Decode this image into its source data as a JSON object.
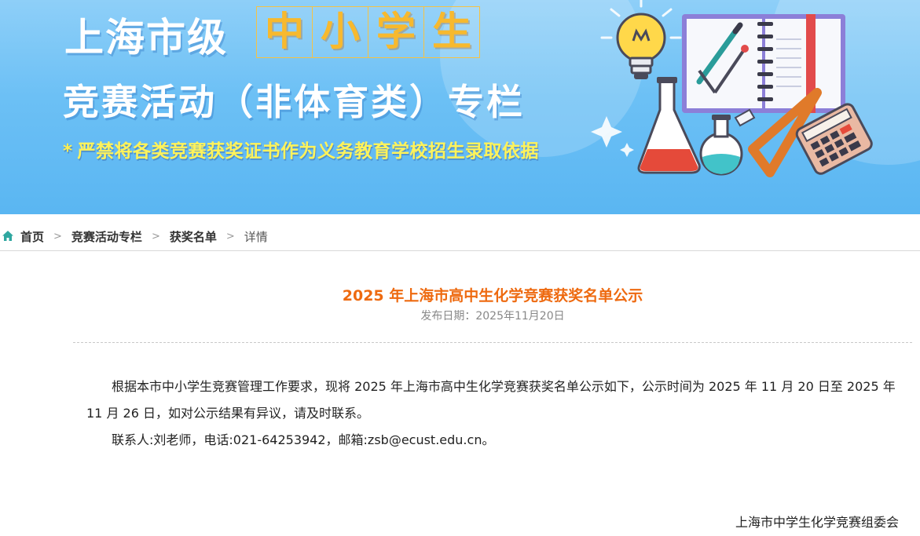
{
  "banner": {
    "title_prefix": "上海市级",
    "title_highlight": [
      "中",
      "小",
      "学",
      "生"
    ],
    "title_line2": "竞赛活动（非体育类）专栏",
    "notice_star": "*",
    "notice": "严禁将各类竞赛获奖证书作为义务教育学校招生录取依据"
  },
  "breadcrumb": {
    "home": "首页",
    "items": [
      "竞赛活动专栏",
      "获奖名单"
    ],
    "current": "详情",
    "separator": ">"
  },
  "article": {
    "title": "2025 年上海市高中生化学竞赛获奖名单公示",
    "publish_date": "发布日期：2025年11月20日",
    "paragraphs": [
      "根据本市中小学生竞赛管理工作要求，现将 2025 年上海市高中生化学竞赛获奖名单公示如下，公示时间为 2025 年 11 月 20 日至 2025 年 11 月 26 日，如对公示结果有异议，请及时联系。",
      "联系人:刘老师，电话:021-64253942，邮箱:zsb@ecust.edu.cn。"
    ],
    "signature": "上海市中学生化学竞赛组委会"
  },
  "colors": {
    "title_accent": "#ee6a10",
    "banner_blue": "#6cc0f5",
    "highlight_gold": "#f7b92e",
    "notice_yellow": "#fff35a",
    "home_icon": "#2fa7a0"
  },
  "icons": [
    "home-icon",
    "chevron-right-icon",
    "lightbulb-icon",
    "notebook-icon",
    "flask-icon",
    "ruler-icon",
    "calculator-icon",
    "compass-icon"
  ]
}
